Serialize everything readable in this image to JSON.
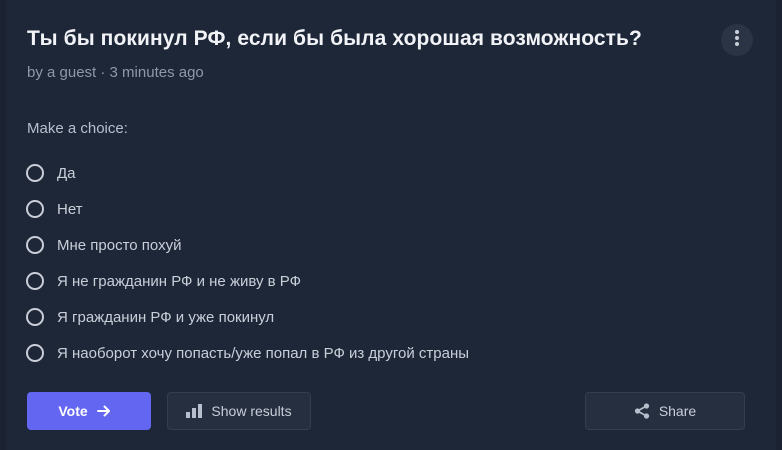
{
  "poll": {
    "title": "Ты бы покинул РФ, если бы была хорошая возможность?",
    "meta": "by a guest · 3 minutes ago",
    "prompt": "Make a choice:",
    "options": [
      "Да",
      "Нет",
      "Мне просто похуй",
      "Я не гражданин РФ и не живу в РФ",
      "Я гражданин РФ и уже покинул",
      "Я наоборот хочу попасть/уже попал в РФ из другой страны"
    ]
  },
  "actions": {
    "vote_label": "Vote",
    "results_label": "Show results",
    "share_label": "Share"
  },
  "colors": {
    "accent": "#6366f1",
    "background": "#1e2738"
  },
  "icons": [
    "more-vertical-icon",
    "arrow-right-icon",
    "bar-chart-icon",
    "share-icon"
  ]
}
